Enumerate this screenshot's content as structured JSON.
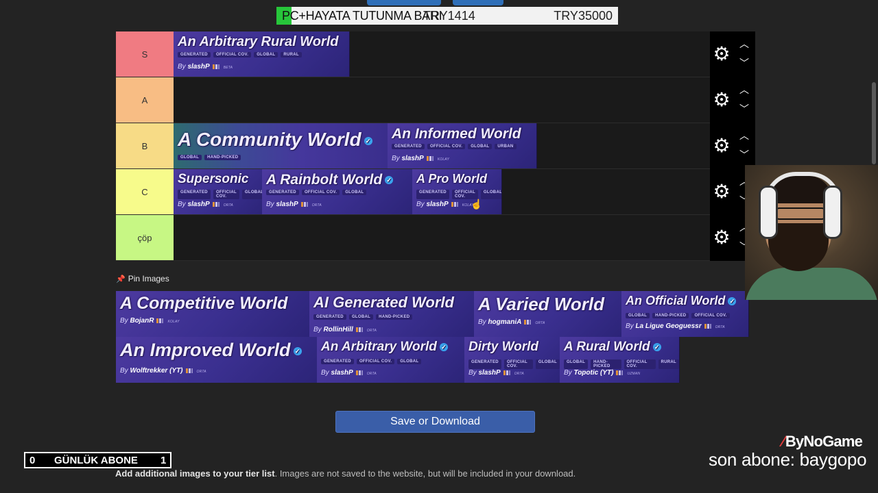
{
  "overlay": {
    "bar_text": "PC+HAYATA TUTUNMA BARI",
    "bar_value": "TRY1414",
    "bar_goal": "TRY35000"
  },
  "tiers": [
    {
      "label": "S",
      "color": "#f07b82",
      "cards": [
        {
          "title": "An Arbitrary Rural World",
          "tags": [
            "GENERATED",
            "OFFICIAL COV.",
            "GLOBAL",
            "RURAL"
          ],
          "author": "slashP",
          "level": "BETA"
        }
      ]
    },
    {
      "label": "A",
      "color": "#f8bd84",
      "cards": []
    },
    {
      "label": "B",
      "color": "#f7db86",
      "cards": [
        {
          "title": "A Community World",
          "tags": [
            "GLOBAL",
            "HAND-PICKED"
          ],
          "author": "",
          "level": "",
          "verified": true
        },
        {
          "title": "An Informed World",
          "tags": [
            "GENERATED",
            "OFFICIAL COV.",
            "GLOBAL",
            "URBAN"
          ],
          "author": "slashP",
          "level": "KOLAY"
        }
      ]
    },
    {
      "label": "C",
      "color": "#f7fb8b",
      "cards": [
        {
          "title": "Supersonic",
          "tags": [
            "GENERATED",
            "OFFICIAL COV.",
            "GLOBAL"
          ],
          "author": "slashP",
          "level": "ORTA"
        },
        {
          "title": "A Rainbolt World",
          "tags": [
            "GENERATED",
            "OFFICIAL COV.",
            "GLOBAL"
          ],
          "author": "slashP",
          "level": "ORTA",
          "verified": true
        },
        {
          "title": "A Pro World",
          "tags": [
            "GENERATED",
            "OFFICIAL COV.",
            "GLOBAL"
          ],
          "author": "slashP",
          "level": "KOLAY"
        }
      ]
    },
    {
      "label": "çöp",
      "color": "#c7f784",
      "cards": []
    }
  ],
  "pin_label": "Pin Images",
  "pool": [
    {
      "title": "A Competitive World",
      "tags": [],
      "author": "BojanR",
      "level": "KOLAY"
    },
    {
      "title": "AI Generated World",
      "tags": [
        "GENERATED",
        "GLOBAL",
        "HAND-PICKED"
      ],
      "author": "RollinHill",
      "level": "ORTA"
    },
    {
      "title": "A Varied World",
      "tags": [],
      "author": "hogmaniA",
      "level": "ORTA"
    },
    {
      "title": "An Official World",
      "tags": [
        "GLOBAL",
        "HAND-PICKED",
        "OFFICIAL COV."
      ],
      "author": "La Ligue Geoguessr",
      "level": "ORTA",
      "verified": true
    },
    {
      "title": "An Improved World",
      "tags": [],
      "author": "Wolftrekker (YT)",
      "level": "ORTA",
      "verified": true
    },
    {
      "title": "An Arbitrary World",
      "tags": [
        "GENERATED",
        "OFFICIAL COV.",
        "GLOBAL"
      ],
      "author": "slashP",
      "level": "ORTA",
      "verified": true
    },
    {
      "title": "Dirty World",
      "tags": [
        "GENERATED",
        "OFFICIAL COV.",
        "GLOBAL"
      ],
      "author": "slashP",
      "level": "ORTA"
    },
    {
      "title": "A Rural World",
      "tags": [
        "GLOBAL",
        "HAND-PICKED",
        "OFFICIAL COV.",
        "RURAL"
      ],
      "author": "Topotic (YT)",
      "level": "UZMAN",
      "verified": true
    }
  ],
  "save_label": "Save or Download",
  "hint": {
    "bold": "Add additional images to your tier list",
    "rest": ". Images are not saved to the website, but will be included in your download."
  },
  "subs": {
    "left": "0",
    "label": "GÜNLÜK ABONE",
    "right": "1"
  },
  "brand": "ByNoGame",
  "last_sub": "son abone: baygopo",
  "icons": {
    "gear": "gear-icon",
    "up": "chevron-up-icon",
    "down": "chevron-down-icon",
    "pin": "pin-icon"
  }
}
